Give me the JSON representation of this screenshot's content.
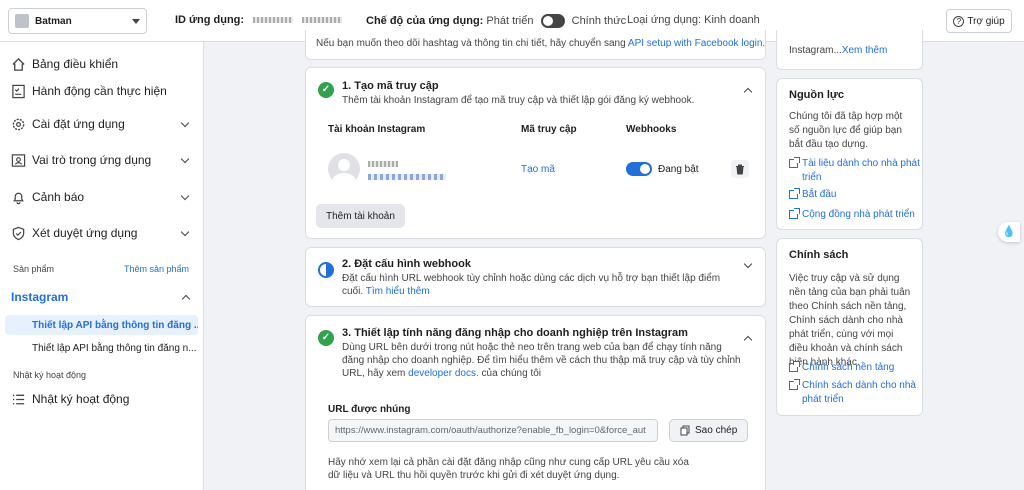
{
  "header": {
    "app_name": "Batman",
    "app_id_label": "ID ứng dụng:",
    "mode_label": "Chế độ của ứng dụng:",
    "mode_dev": "Phát triển",
    "mode_live": "Chính thức",
    "type_label": "Loại ứng dụng:",
    "type_value": "Kinh doanh",
    "help_label": "Trợ giúp"
  },
  "sidebar": {
    "items": [
      {
        "label": "Bảng điều khiển"
      },
      {
        "label": "Hành động cần thực hiện"
      },
      {
        "label": "Cài đặt ứng dụng"
      },
      {
        "label": "Vai trò trong ứng dụng"
      },
      {
        "label": "Cảnh báo"
      },
      {
        "label": "Xét duyệt ứng dụng"
      }
    ],
    "products_label": "Sản phẩm",
    "add_product_label": "Thêm sản phẩm",
    "instagram_label": "Instagram",
    "sub_items": [
      "Thiết lập API bằng thông tin đăng ...",
      "Thiết lập API bằng thông tin đăng n..."
    ],
    "activity_section": "Nhật ký hoạt động",
    "activity_item": "Nhật ký hoạt động"
  },
  "main": {
    "top_note": "Nếu bạn muốn theo dõi hashtag và thông tin chi tiết, hãy chuyển sang",
    "top_note_link": "API setup with Facebook login.",
    "step1": {
      "title": "1. Tạo mã truy cập",
      "desc": "Thêm tài khoản Instagram để tạo mã truy cập và thiết lập gói đăng ký webhook.",
      "col_account": "Tài khoản Instagram",
      "col_token": "Mã truy cập",
      "col_webhooks": "Webhooks",
      "create_token": "Tạo mã",
      "webhook_status": "Đang bật",
      "add_account": "Thêm tài khoản"
    },
    "step2": {
      "title": "2. Đặt cấu hình webhook",
      "desc": "Đặt cấu hình URL webhook tùy chỉnh hoặc dùng các dịch vụ hỗ trợ bạn thiết lập điểm cuối.",
      "learn_more": "Tìm hiểu thêm"
    },
    "step3": {
      "title": "3. Thiết lập tính năng đăng nhập cho doanh nghiệp trên Instagram",
      "desc_line1": "Dùng URL bên dưới trong nút hoặc thẻ neo trên trang web của bạn để chạy tính năng",
      "desc_line2": "đăng nhập cho doanh nghiệp. Để tìm hiểu thêm về cách thu thập mã truy cập và tùy chỉnh",
      "desc_line3_a": "URL, hãy xem",
      "desc_link": "developer docs.",
      "desc_line3_b": "của chúng tôi",
      "embed_label": "URL được nhúng",
      "embed_url": "https://www.instagram.com/oauth/authorize?enable_fb_login=0&force_aut",
      "copy_label": "Sao chép",
      "note_line1": "Hãy nhớ xem lại cả phần cài đặt đăng nhập cũng như cung cấp URL yêu cầu xóa",
      "note_line2": "dữ liệu và URL thu hồi quyền trước khi gửi đi xét duyệt ứng dụng."
    }
  },
  "right": {
    "top_text": "Instagram...",
    "top_link": "Xem thêm",
    "resources": {
      "title": "Nguồn lực",
      "desc": "Chúng tôi đã tập hợp một số nguồn lực để giúp bạn bắt đầu tạo dựng.",
      "links": [
        "Tài liệu dành cho nhà phát triển",
        "Bắt đầu",
        "Cộng đồng nhà phát triển"
      ]
    },
    "policy": {
      "title": "Chính sách",
      "desc": "Việc truy cập và sử dụng nền tảng của bạn phải tuân theo Chính sách nền tảng, Chính sách dành cho nhà phát triển, cùng với mọi điều khoản và chính sách hiện hành khác.",
      "links": [
        "Chính sách nền tảng",
        "Chính sách dành cho nhà phát triển"
      ]
    }
  },
  "colors": {
    "accent": "#216fdb",
    "success": "#31a24c"
  }
}
